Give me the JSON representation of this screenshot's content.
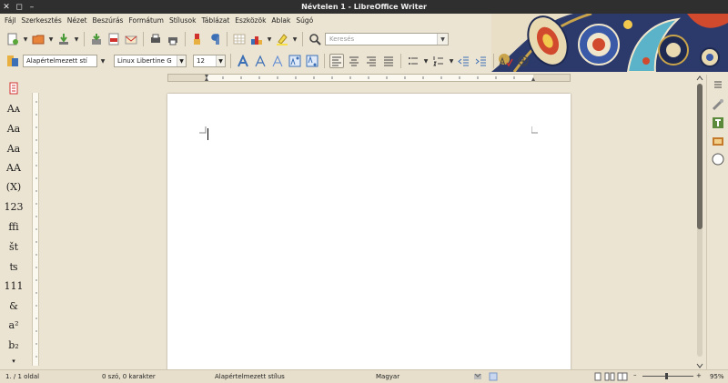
{
  "window": {
    "title": "Névtelen 1 - LibreOffice Writer",
    "close_glyph": "✕",
    "restore_glyph": "◻",
    "minimize_glyph": "–"
  },
  "menu": [
    "Fájl",
    "Szerkesztés",
    "Nézet",
    "Beszúrás",
    "Formátum",
    "Stílusok",
    "Táblázat",
    "Eszközök",
    "Ablak",
    "Súgó"
  ],
  "toolbar": {
    "search_placeholder": "Keresés",
    "paragraph_style": "Alapértelmezett stí",
    "font_name": "Linux Libertine G",
    "font_size": "12",
    "dropdown_arrow": "▼"
  },
  "sidebar_chars": [
    "Aᴀ",
    "Aa",
    "Aa",
    "AA",
    "(X)",
    "123",
    "ffi",
    "št",
    "ʦ",
    "111",
    "&",
    "a²",
    "b₂",
    "▾"
  ],
  "statusbar": {
    "page": "1. / 1 oldal",
    "words": "0 szó, 0 karakter",
    "page_style": "Alapértelmezett stílus",
    "language": "Magyar",
    "zoom_minus": "–",
    "zoom_plus": "+",
    "zoom": "95%"
  },
  "zoom_level": 0.95,
  "colors": {
    "chrome": "#ece4d2",
    "titlebar": "#2f2f2f",
    "page": "#ffffff",
    "accent_blue": "#3b6fb6"
  }
}
